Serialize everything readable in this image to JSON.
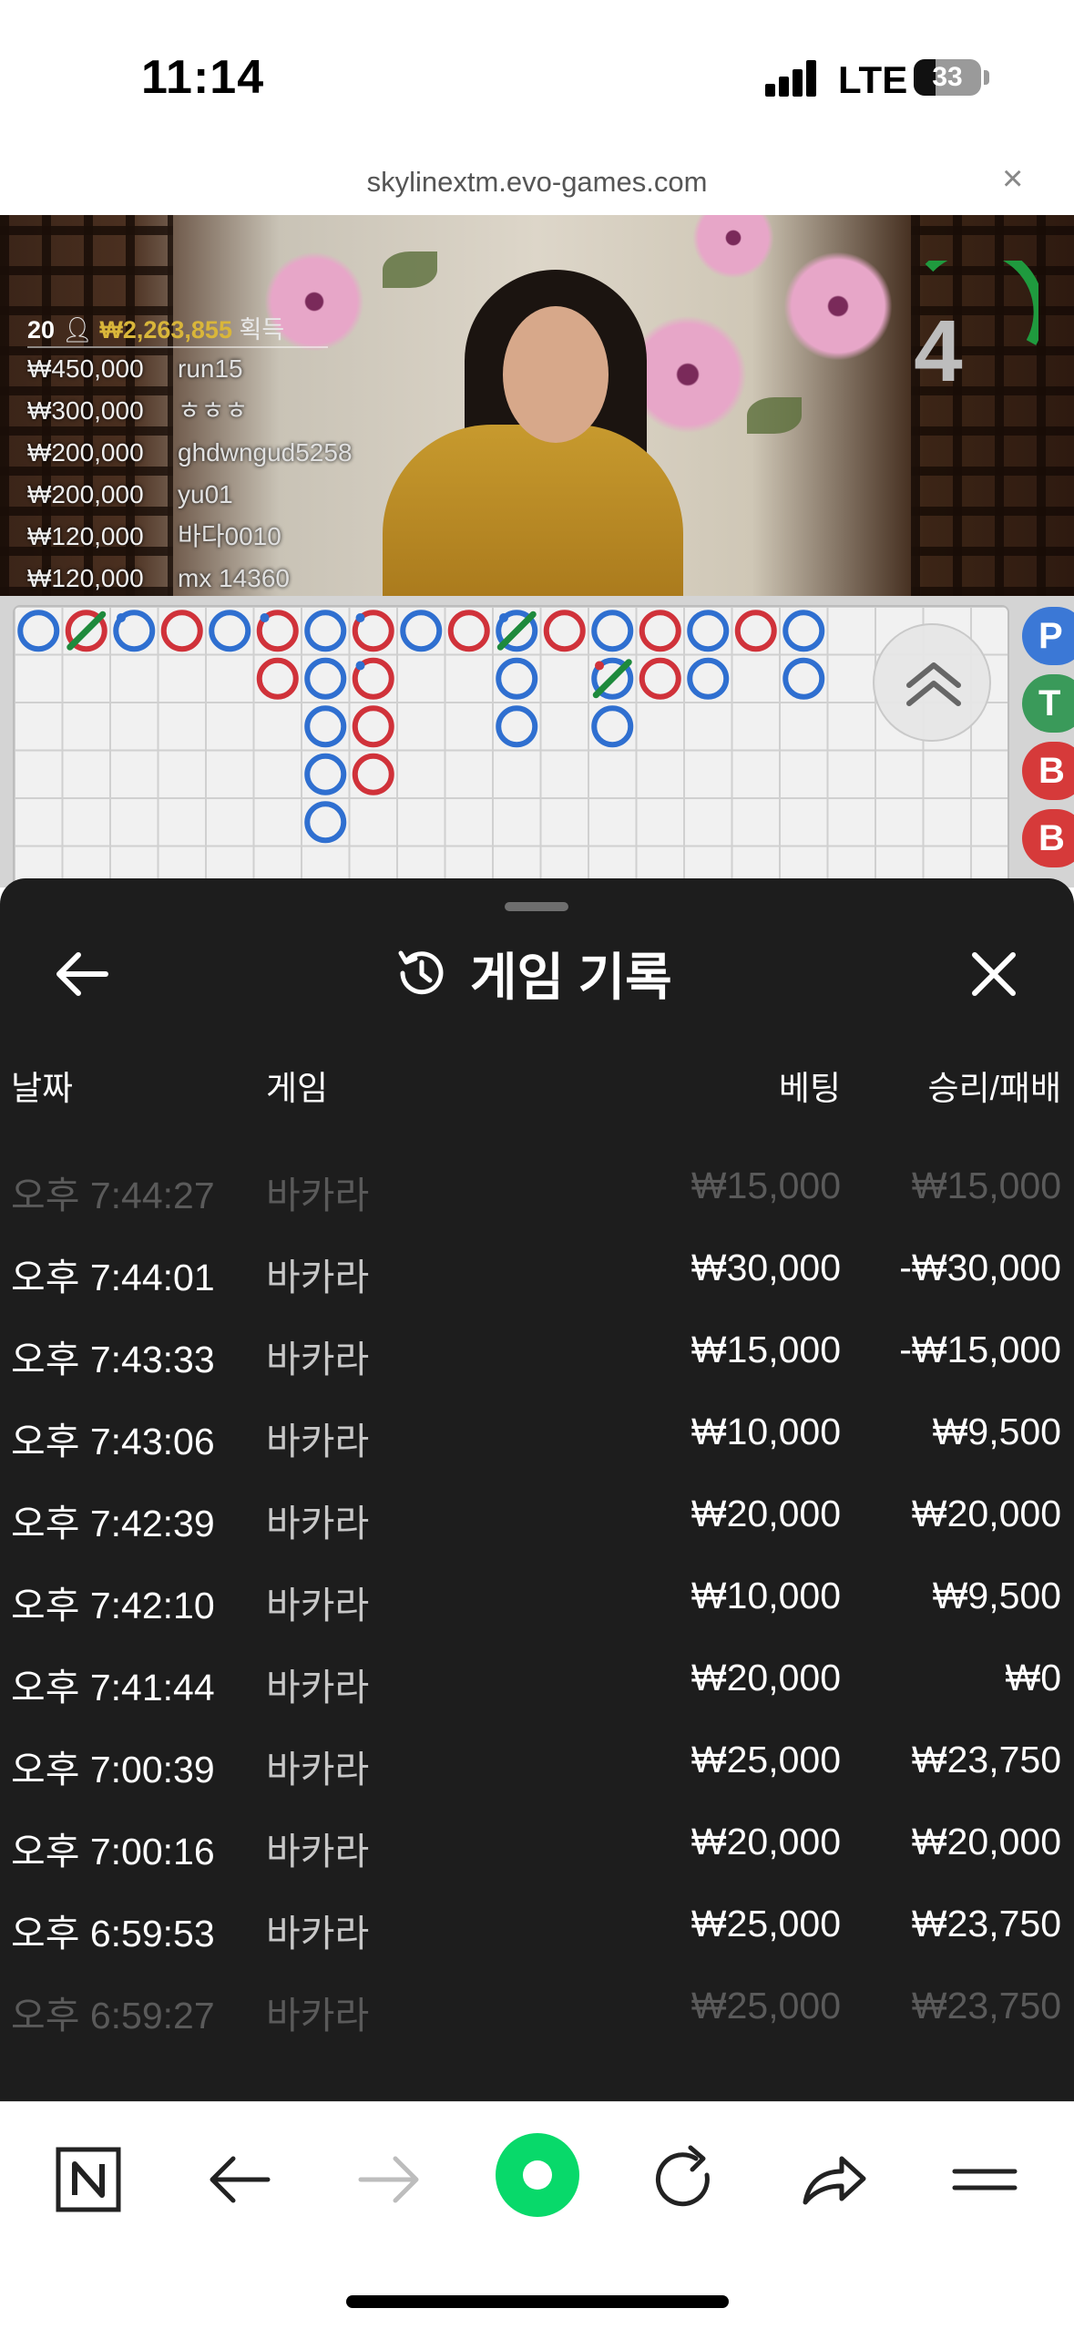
{
  "status_bar": {
    "time": "11:14",
    "network": "LTE",
    "battery": "33"
  },
  "browser": {
    "url": "skylinextm.evo-games.com",
    "close_label": "×"
  },
  "video": {
    "countdown": "4",
    "player_count": "20",
    "total_prize": "₩2,263,855",
    "prize_suffix": "획득",
    "winners": [
      {
        "amount": "₩450,000",
        "name": "run15"
      },
      {
        "amount": "₩300,000",
        "name": "ㅎㅎㅎ"
      },
      {
        "amount": "₩200,000",
        "name": "ghdwngud5258"
      },
      {
        "amount": "₩200,000",
        "name": "yu01"
      },
      {
        "amount": "₩120,000",
        "name": "바다0010"
      },
      {
        "amount": "₩120,000",
        "name": "mx 14360"
      }
    ]
  },
  "road": {
    "side_tabs": [
      {
        "letter": "P",
        "color": "#3b78d6"
      },
      {
        "letter": "T",
        "color": "#3a9a5a"
      },
      {
        "letter": "B",
        "color": "#d63a3a"
      },
      {
        "letter": "B",
        "color": "#d63a3a"
      }
    ],
    "colors": {
      "player": "#2f6fd0",
      "banker": "#d0323a",
      "tie": "#1e8a3c"
    }
  },
  "history": {
    "title": "게임 기록",
    "columns": {
      "date": "날짜",
      "game": "게임",
      "bet": "베팅",
      "result": "승리/패배"
    },
    "rows": [
      {
        "date": "오후 7:44:27",
        "game": "바카라",
        "bet": "₩15,000",
        "result": "₩15,000"
      },
      {
        "date": "오후 7:44:01",
        "game": "바카라",
        "bet": "₩30,000",
        "result": "-₩30,000"
      },
      {
        "date": "오후 7:43:33",
        "game": "바카라",
        "bet": "₩15,000",
        "result": "-₩15,000"
      },
      {
        "date": "오후 7:43:06",
        "game": "바카라",
        "bet": "₩10,000",
        "result": "₩9,500"
      },
      {
        "date": "오후 7:42:39",
        "game": "바카라",
        "bet": "₩20,000",
        "result": "₩20,000"
      },
      {
        "date": "오후 7:42:10",
        "game": "바카라",
        "bet": "₩10,000",
        "result": "₩9,500"
      },
      {
        "date": "오후 7:41:44",
        "game": "바카라",
        "bet": "₩20,000",
        "result": "₩0"
      },
      {
        "date": "오후 7:00:39",
        "game": "바카라",
        "bet": "₩25,000",
        "result": "₩23,750"
      },
      {
        "date": "오후 7:00:16",
        "game": "바카라",
        "bet": "₩20,000",
        "result": "₩20,000"
      },
      {
        "date": "오후 6:59:53",
        "game": "바카라",
        "bet": "₩25,000",
        "result": "₩23,750"
      },
      {
        "date": "오후 6:59:27",
        "game": "바카라",
        "bet": "₩25,000",
        "result": "₩23,750"
      }
    ]
  },
  "toolbar": {
    "items": [
      "naver-logo-icon",
      "back-arrow-icon",
      "forward-arrow-icon",
      "green-dot-icon",
      "reload-icon",
      "share-icon",
      "menu-icon"
    ],
    "accent": "#08d96a"
  }
}
